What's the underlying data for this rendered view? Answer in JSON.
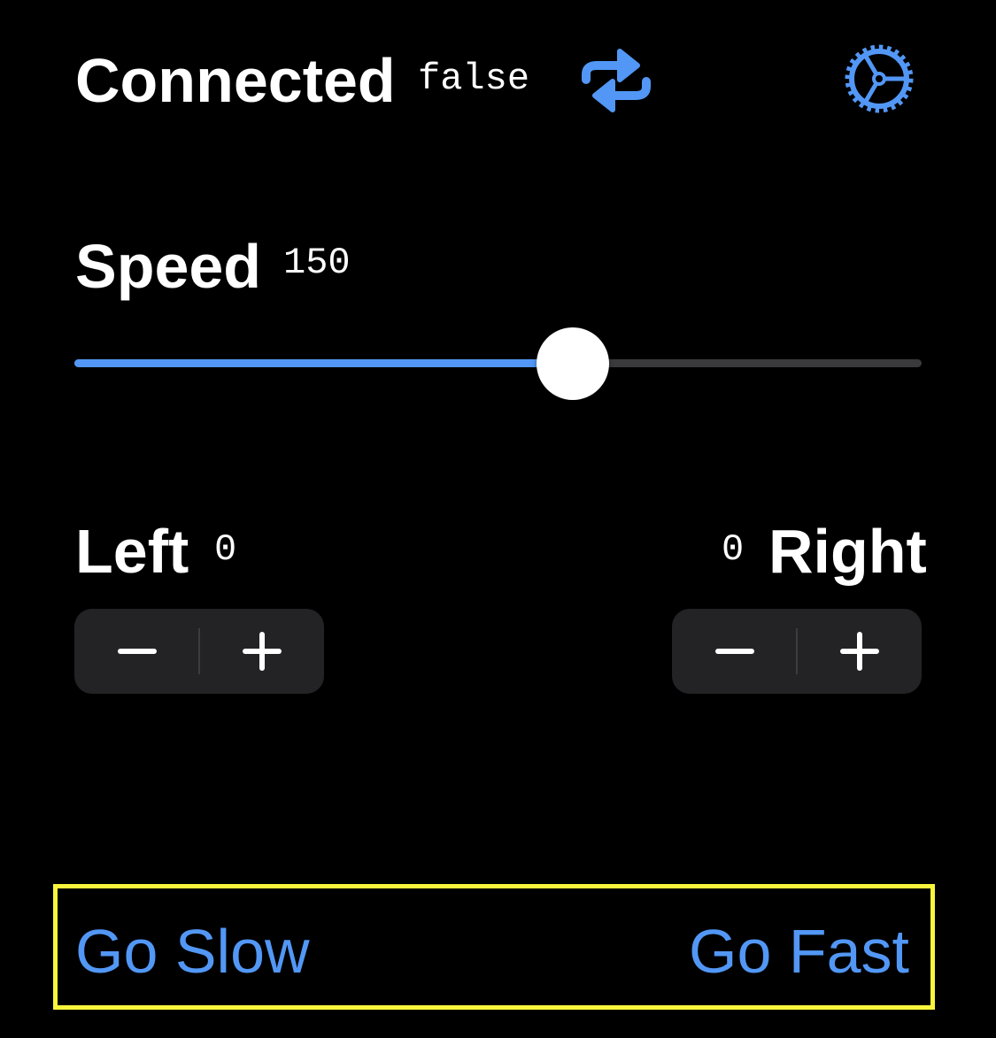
{
  "header": {
    "connected_label": "Connected",
    "connected_value": "false",
    "reconnect_icon": "arrows-repeat-icon",
    "settings_icon": "gear-icon"
  },
  "speed": {
    "label": "Speed",
    "value": "150",
    "min": 0,
    "max": 255,
    "current": 150
  },
  "left": {
    "label": "Left",
    "value": "0"
  },
  "right": {
    "label": "Right",
    "value": "0"
  },
  "stepper": {
    "minus": "−",
    "plus": "+"
  },
  "actions": {
    "slow": "Go Slow",
    "fast": "Go Fast"
  },
  "colors": {
    "accent": "#5297f5",
    "highlight": "#f9f53b"
  }
}
